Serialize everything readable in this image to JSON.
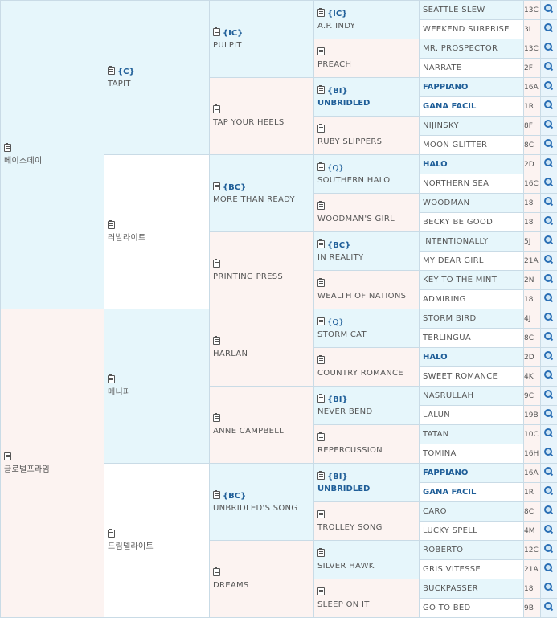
{
  "pedigree": {
    "sire": {
      "name": "베이스데이",
      "group": "",
      "children": [
        {
          "name": "TAPIT",
          "group": "{C}",
          "children": [
            {
              "name": "PULPIT",
              "group": "{IC}",
              "children": [
                {
                  "name": "A.P. INDY",
                  "group": "{IC}",
                  "hl": false,
                  "children": [
                    {
                      "name": "SEATTLE SLEW",
                      "hl": false,
                      "code": "13C"
                    },
                    {
                      "name": "WEEKEND SURPRISE",
                      "hl": false,
                      "code": "3L"
                    }
                  ]
                },
                {
                  "name": "PREACH",
                  "group": "",
                  "hl": false,
                  "children": [
                    {
                      "name": "MR. PROSPECTOR",
                      "hl": false,
                      "code": "13C"
                    },
                    {
                      "name": "NARRATE",
                      "hl": false,
                      "code": "2F"
                    }
                  ]
                }
              ]
            },
            {
              "name": "TAP YOUR HEELS",
              "group": "",
              "children": [
                {
                  "name": "UNBRIDLED",
                  "group": "{BI}",
                  "hl": true,
                  "children": [
                    {
                      "name": "FAPPIANO",
                      "hl": true,
                      "code": "16A"
                    },
                    {
                      "name": "GANA FACIL",
                      "hl": true,
                      "code": "1R"
                    }
                  ]
                },
                {
                  "name": "RUBY SLIPPERS",
                  "group": "",
                  "hl": false,
                  "children": [
                    {
                      "name": "NIJINSKY",
                      "hl": false,
                      "code": "8F"
                    },
                    {
                      "name": "MOON GLITTER",
                      "hl": false,
                      "code": "8C"
                    }
                  ]
                }
              ]
            }
          ]
        },
        {
          "name": "러발라이트",
          "group": "",
          "children": [
            {
              "name": "MORE THAN READY",
              "group": "{BC}",
              "children": [
                {
                  "name": "SOUTHERN HALO",
                  "group": "{Q}",
                  "q": true,
                  "hl": false,
                  "children": [
                    {
                      "name": "HALO",
                      "hl": true,
                      "code": "2D"
                    },
                    {
                      "name": "NORTHERN SEA",
                      "hl": false,
                      "code": "16C"
                    }
                  ]
                },
                {
                  "name": "WOODMAN'S GIRL",
                  "group": "",
                  "hl": false,
                  "children": [
                    {
                      "name": "WOODMAN",
                      "hl": false,
                      "code": "18"
                    },
                    {
                      "name": "BECKY BE GOOD",
                      "hl": false,
                      "code": "18"
                    }
                  ]
                }
              ]
            },
            {
              "name": "PRINTING PRESS",
              "group": "",
              "children": [
                {
                  "name": "IN REALITY",
                  "group": "{BC}",
                  "hl": false,
                  "children": [
                    {
                      "name": "INTENTIONALLY",
                      "hl": false,
                      "code": "5J"
                    },
                    {
                      "name": "MY DEAR GIRL",
                      "hl": false,
                      "code": "21A"
                    }
                  ]
                },
                {
                  "name": "WEALTH OF NATIONS",
                  "group": "",
                  "hl": false,
                  "children": [
                    {
                      "name": "KEY TO THE MINT",
                      "hl": false,
                      "code": "2N"
                    },
                    {
                      "name": "ADMIRING",
                      "hl": false,
                      "code": "18"
                    }
                  ]
                }
              ]
            }
          ]
        }
      ]
    },
    "dam": {
      "name": "글로벌프라임",
      "group": "",
      "children": [
        {
          "name": "메니피",
          "group": "",
          "children": [
            {
              "name": "HARLAN",
              "group": "",
              "children": [
                {
                  "name": "STORM CAT",
                  "group": "{Q}",
                  "q": true,
                  "hl": false,
                  "children": [
                    {
                      "name": "STORM BIRD",
                      "hl": false,
                      "code": "4J"
                    },
                    {
                      "name": "TERLINGUA",
                      "hl": false,
                      "code": "8C"
                    }
                  ]
                },
                {
                  "name": "COUNTRY ROMANCE",
                  "group": "",
                  "hl": false,
                  "children": [
                    {
                      "name": "HALO",
                      "hl": true,
                      "code": "2D"
                    },
                    {
                      "name": "SWEET ROMANCE",
                      "hl": false,
                      "code": "4K"
                    }
                  ]
                }
              ]
            },
            {
              "name": "ANNE CAMPBELL",
              "group": "",
              "children": [
                {
                  "name": "NEVER BEND",
                  "group": "{BI}",
                  "hl": false,
                  "children": [
                    {
                      "name": "NASRULLAH",
                      "hl": false,
                      "code": "9C"
                    },
                    {
                      "name": "LALUN",
                      "hl": false,
                      "code": "19B"
                    }
                  ]
                },
                {
                  "name": "REPERCUSSION",
                  "group": "",
                  "hl": false,
                  "children": [
                    {
                      "name": "TATAN",
                      "hl": false,
                      "code": "10C"
                    },
                    {
                      "name": "TOMINA",
                      "hl": false,
                      "code": "16H"
                    }
                  ]
                }
              ]
            }
          ]
        },
        {
          "name": "드림델라이트",
          "group": "",
          "children": [
            {
              "name": "UNBRIDLED'S SONG",
              "group": "{BC}",
              "children": [
                {
                  "name": "UNBRIDLED",
                  "group": "{BI}",
                  "hl": true,
                  "children": [
                    {
                      "name": "FAPPIANO",
                      "hl": true,
                      "code": "16A"
                    },
                    {
                      "name": "GANA FACIL",
                      "hl": true,
                      "code": "1R"
                    }
                  ]
                },
                {
                  "name": "TROLLEY SONG",
                  "group": "",
                  "hl": false,
                  "children": [
                    {
                      "name": "CARO",
                      "hl": false,
                      "code": "8C"
                    },
                    {
                      "name": "LUCKY SPELL",
                      "hl": false,
                      "code": "4M"
                    }
                  ]
                }
              ]
            },
            {
              "name": "DREAMS",
              "group": "",
              "children": [
                {
                  "name": "SILVER HAWK",
                  "group": "",
                  "hl": false,
                  "children": [
                    {
                      "name": "ROBERTO",
                      "hl": false,
                      "code": "12C"
                    },
                    {
                      "name": "GRIS VITESSE",
                      "hl": false,
                      "code": "21A"
                    }
                  ]
                },
                {
                  "name": "SLEEP ON IT",
                  "group": "",
                  "hl": false,
                  "children": [
                    {
                      "name": "BUCKPASSER",
                      "hl": false,
                      "code": "18"
                    },
                    {
                      "name": "GO TO BED",
                      "hl": false,
                      "code": "9B"
                    }
                  ]
                }
              ]
            }
          ]
        }
      ]
    }
  },
  "icons": {
    "clipboard": "clipboard-icon",
    "search": "search-icon"
  },
  "colors": {
    "sire_bg": "#e6f6fb",
    "dam_bg": "#fcf3f1",
    "link": "#1f5e98",
    "border": "#c9dbe6"
  }
}
